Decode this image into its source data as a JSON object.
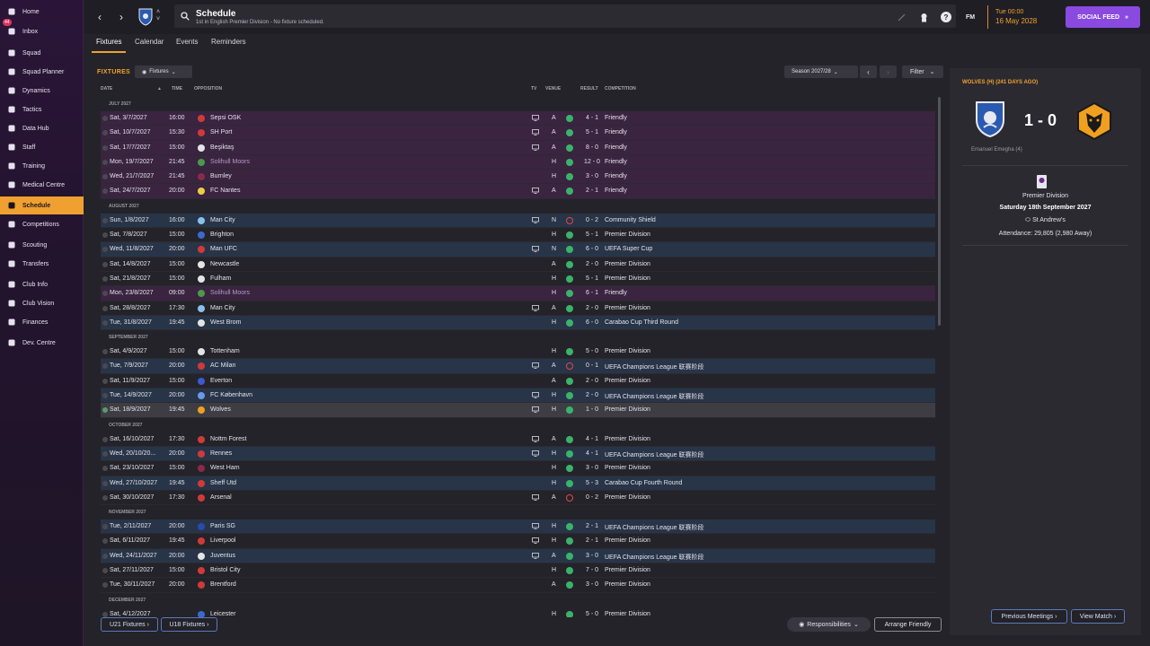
{
  "sidebar": {
    "items": [
      {
        "label": "Home",
        "icon": "home-icon"
      },
      {
        "label": "Inbox",
        "icon": "inbox-icon",
        "badge": "44"
      },
      {
        "label": "Squad",
        "icon": "shirt-icon"
      },
      {
        "label": "Squad Planner",
        "icon": "planner-icon"
      },
      {
        "label": "Dynamics",
        "icon": "dynamics-icon"
      },
      {
        "label": "Tactics",
        "icon": "tactics-icon"
      },
      {
        "label": "Data Hub",
        "icon": "data-hub-icon"
      },
      {
        "label": "Staff",
        "icon": "staff-icon"
      },
      {
        "label": "Training",
        "icon": "training-icon"
      },
      {
        "label": "Medical Centre",
        "icon": "medical-icon"
      },
      {
        "label": "Schedule",
        "icon": "calendar-icon",
        "active": true
      },
      {
        "label": "Competitions",
        "icon": "trophy-icon"
      },
      {
        "label": "Scouting",
        "icon": "scouting-icon"
      },
      {
        "label": "Transfers",
        "icon": "transfers-icon"
      },
      {
        "label": "Club Info",
        "icon": "info-icon"
      },
      {
        "label": "Club Vision",
        "icon": "vision-icon"
      },
      {
        "label": "Finances",
        "icon": "finances-icon"
      },
      {
        "label": "Dev. Centre",
        "icon": "dev-centre-icon"
      }
    ]
  },
  "topbar": {
    "title": "Schedule",
    "subtitle": "1st in English Premier Division - No fixture scheduled.",
    "fm_label": "FM",
    "time": "Tue 00:00",
    "date": "16 May 2028",
    "social_feed": "SOCIAL FEED"
  },
  "tabs": [
    "Fixtures",
    "Calendar",
    "Events",
    "Reminders"
  ],
  "main": {
    "heading": "FIXTURES",
    "view_dropdown": "Fixtures",
    "season": "Season 2027/28",
    "filter": "Filter",
    "columns": {
      "date": "DATE",
      "time": "TIME",
      "opposition": "OPPOSITION",
      "tv": "TV",
      "venue": "VENUE",
      "result": "RESULT",
      "competition": "COMPETITION"
    }
  },
  "months": [
    {
      "name": "JULY 2027",
      "fixtures": [
        {
          "date": "Sat, 3/7/2027",
          "time": "16:00",
          "opp": "Sepsi OSK",
          "tv": true,
          "venue": "A",
          "result": "4 - 1",
          "outcome": "win",
          "comp": "Friendly",
          "type": "friendly",
          "crest": "#d03a3a"
        },
        {
          "date": "Sat, 10/7/2027",
          "time": "15:30",
          "opp": "SH Port",
          "tv": true,
          "venue": "A",
          "result": "5 - 1",
          "outcome": "win",
          "comp": "Friendly",
          "type": "friendly",
          "crest": "#d03a3a"
        },
        {
          "date": "Sat, 17/7/2027",
          "time": "15:00",
          "opp": "Beşiktaş",
          "tv": true,
          "venue": "A",
          "result": "8 - 0",
          "outcome": "win",
          "comp": "Friendly",
          "type": "friendly",
          "crest": "#e4e4e4"
        },
        {
          "date": "Mon, 19/7/2027",
          "time": "21:45",
          "opp": "Solihull Moors",
          "tv": false,
          "venue": "H",
          "result": "12 - 0",
          "outcome": "win",
          "comp": "Friendly",
          "type": "friendly",
          "crest": "#4a9a4a",
          "dim": true
        },
        {
          "date": "Wed, 21/7/2027",
          "time": "21:45",
          "opp": "Burnley",
          "tv": false,
          "venue": "H",
          "result": "3 - 0",
          "outcome": "win",
          "comp": "Friendly",
          "type": "friendly",
          "crest": "#8a2a4a"
        },
        {
          "date": "Sat, 24/7/2027",
          "time": "20:00",
          "opp": "FC Nantes",
          "tv": true,
          "venue": "A",
          "result": "2 - 1",
          "outcome": "win",
          "comp": "Friendly",
          "type": "friendly",
          "crest": "#e8d040"
        }
      ]
    },
    {
      "name": "AUGUST 2027",
      "fixtures": [
        {
          "date": "Sun, 1/8/2027",
          "time": "16:00",
          "opp": "Man City",
          "tv": true,
          "venue": "N",
          "result": "0 - 2",
          "outcome": "loss",
          "comp": "Community Shield",
          "type": "cup",
          "crest": "#8ac0e8"
        },
        {
          "date": "Sat, 7/8/2027",
          "time": "15:00",
          "opp": "Brighton",
          "tv": false,
          "venue": "H",
          "result": "5 - 1",
          "outcome": "win",
          "comp": "Premier Division",
          "type": "league",
          "crest": "#3a6ad0"
        },
        {
          "date": "Wed, 11/8/2027",
          "time": "20:00",
          "opp": "Man UFC",
          "tv": true,
          "venue": "N",
          "result": "6 - 0",
          "outcome": "win",
          "comp": "UEFA Super Cup",
          "type": "cup",
          "crest": "#d03a3a"
        },
        {
          "date": "Sat, 14/8/2027",
          "time": "15:00",
          "opp": "Newcastle",
          "tv": false,
          "venue": "A",
          "result": "2 - 0",
          "outcome": "win",
          "comp": "Premier Division",
          "type": "league",
          "crest": "#e4e4e4"
        },
        {
          "date": "Sat, 21/8/2027",
          "time": "15:00",
          "opp": "Fulham",
          "tv": false,
          "venue": "H",
          "result": "5 - 1",
          "outcome": "win",
          "comp": "Premier Division",
          "type": "league",
          "crest": "#e4e4e4"
        },
        {
          "date": "Mon, 23/8/2027",
          "time": "09:00",
          "opp": "Solihull Moors",
          "tv": false,
          "venue": "H",
          "result": "6 - 1",
          "outcome": "win",
          "comp": "Friendly",
          "type": "friendly",
          "crest": "#4a9a4a",
          "dim": true
        },
        {
          "date": "Sat, 28/8/2027",
          "time": "17:30",
          "opp": "Man City",
          "tv": true,
          "venue": "A",
          "result": "2 - 0",
          "outcome": "win",
          "comp": "Premier Division",
          "type": "league",
          "crest": "#8ac0e8"
        },
        {
          "date": "Tue, 31/8/2027",
          "time": "19:45",
          "opp": "West Brom",
          "tv": false,
          "venue": "H",
          "result": "6 - 0",
          "outcome": "win",
          "comp": "Carabao Cup Third Round",
          "type": "cup",
          "crest": "#e4e4e4"
        }
      ]
    },
    {
      "name": "SEPTEMBER 2027",
      "fixtures": [
        {
          "date": "Sat, 4/9/2027",
          "time": "15:00",
          "opp": "Tottenham",
          "tv": false,
          "venue": "H",
          "result": "5 - 0",
          "outcome": "win",
          "comp": "Premier Division",
          "type": "league",
          "crest": "#e4e4e4"
        },
        {
          "date": "Tue, 7/9/2027",
          "time": "20:00",
          "opp": "AC Milan",
          "tv": true,
          "venue": "A",
          "result": "0 - 1",
          "outcome": "loss",
          "comp": "UEFA Champions League 联赛阶段",
          "type": "cup",
          "crest": "#d03a3a"
        },
        {
          "date": "Sat, 11/9/2027",
          "time": "15:00",
          "opp": "Everton",
          "tv": false,
          "venue": "A",
          "result": "2 - 0",
          "outcome": "win",
          "comp": "Premier Division",
          "type": "league",
          "crest": "#3a5ad0"
        },
        {
          "date": "Tue, 14/9/2027",
          "time": "20:00",
          "opp": "FC København",
          "tv": true,
          "venue": "H",
          "result": "2 - 0",
          "outcome": "win",
          "comp": "UEFA Champions League 联赛阶段",
          "type": "cup",
          "crest": "#6a9ae8"
        },
        {
          "date": "Sat, 18/9/2027",
          "time": "19:45",
          "opp": "Wolves",
          "tv": true,
          "venue": "H",
          "result": "1 - 0",
          "outcome": "win",
          "comp": "Premier Division",
          "type": "selected",
          "crest": "#f0a020"
        }
      ]
    },
    {
      "name": "OCTOBER 2027",
      "fixtures": [
        {
          "date": "Sat, 16/10/2027",
          "time": "17:30",
          "opp": "Nottm Forest",
          "tv": true,
          "venue": "A",
          "result": "4 - 1",
          "outcome": "win",
          "comp": "Premier Division",
          "type": "league",
          "crest": "#d03a3a"
        },
        {
          "date": "Wed, 20/10/20...",
          "time": "20:00",
          "opp": "Rennes",
          "tv": true,
          "venue": "H",
          "result": "4 - 1",
          "outcome": "win",
          "comp": "UEFA Champions League 联赛阶段",
          "type": "cup",
          "crest": "#d03a3a"
        },
        {
          "date": "Sat, 23/10/2027",
          "time": "15:00",
          "opp": "West Ham",
          "tv": false,
          "venue": "H",
          "result": "3 - 0",
          "outcome": "win",
          "comp": "Premier Division",
          "type": "league",
          "crest": "#8a2a4a"
        },
        {
          "date": "Wed, 27/10/2027",
          "time": "19:45",
          "opp": "Sheff Utd",
          "tv": false,
          "venue": "H",
          "result": "5 - 3",
          "outcome": "win",
          "comp": "Carabao Cup Fourth Round",
          "type": "cup",
          "crest": "#d03a3a"
        },
        {
          "date": "Sat, 30/10/2027",
          "time": "17:30",
          "opp": "Arsenal",
          "tv": true,
          "venue": "A",
          "result": "0 - 2",
          "outcome": "loss",
          "comp": "Premier Division",
          "type": "league",
          "crest": "#d03a3a"
        }
      ]
    },
    {
      "name": "NOVEMBER 2027",
      "fixtures": [
        {
          "date": "Tue, 2/11/2027",
          "time": "20:00",
          "opp": "Paris SG",
          "tv": true,
          "venue": "H",
          "result": "2 - 1",
          "outcome": "win",
          "comp": "UEFA Champions League 联赛阶段",
          "type": "cup",
          "crest": "#2a4ab0"
        },
        {
          "date": "Sat, 6/11/2027",
          "time": "19:45",
          "opp": "Liverpool",
          "tv": true,
          "venue": "H",
          "result": "2 - 1",
          "outcome": "win",
          "comp": "Premier Division",
          "type": "league",
          "crest": "#d03a3a"
        },
        {
          "date": "Wed, 24/11/2027",
          "time": "20:00",
          "opp": "Juventus",
          "tv": true,
          "venue": "A",
          "result": "3 - 0",
          "outcome": "win",
          "comp": "UEFA Champions League 联赛阶段",
          "type": "cup",
          "crest": "#e4e4e4"
        },
        {
          "date": "Sat, 27/11/2027",
          "time": "15:00",
          "opp": "Bristol City",
          "tv": false,
          "venue": "H",
          "result": "7 - 0",
          "outcome": "win",
          "comp": "Premier Division",
          "type": "league",
          "crest": "#d03a3a"
        },
        {
          "date": "Tue, 30/11/2027",
          "time": "20:00",
          "opp": "Brentford",
          "tv": false,
          "venue": "A",
          "result": "3 - 0",
          "outcome": "win",
          "comp": "Premier Division",
          "type": "league",
          "crest": "#d03a3a"
        }
      ]
    },
    {
      "name": "DECEMBER 2027",
      "fixtures": [
        {
          "date": "Sat, 4/12/2027",
          "time": "",
          "opp": "Leicester",
          "tv": false,
          "venue": "H",
          "result": "5 - 0",
          "outcome": "win",
          "comp": "Premier Division",
          "type": "league",
          "crest": "#3a6ad0"
        }
      ]
    }
  ],
  "bottom": {
    "u21": "U21 Fixtures",
    "u18": "U18 Fixtures",
    "responsibilities": "Responsibilities",
    "arrange": "Arrange Friendly",
    "previous_meetings": "Previous Meetings",
    "view_match": "View Match"
  },
  "panel": {
    "title": "WOLVES (H) (241 DAYS AGO)",
    "score": "1 - 0",
    "scorer": "Emanuel Emegha (4)",
    "competition": "Premier Division",
    "date": "Saturday 18th September 2027",
    "venue": "St Andrew's",
    "attendance": "Attendance: 29,805 (2,980 Away)"
  },
  "colors": {
    "accent": "#f0a030",
    "social": "#8a4ae0",
    "win": "#3ab36a",
    "loss": "#e04848"
  }
}
